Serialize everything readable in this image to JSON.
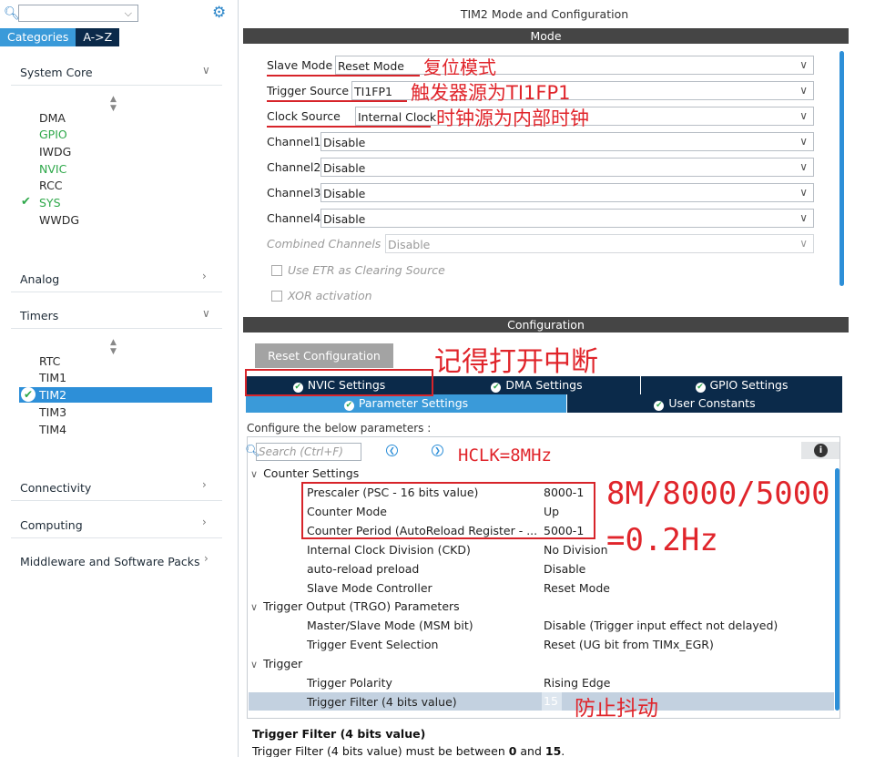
{
  "left": {
    "search_value": "",
    "tabs": [
      "Categories",
      "A->Z"
    ],
    "categories": {
      "system_core": "System Core",
      "system_core_items": [
        "DMA",
        "GPIO",
        "IWDG",
        "NVIC",
        "RCC",
        "SYS",
        "WWDG"
      ],
      "analog": "Analog",
      "timers": "Timers",
      "timers_items": [
        "RTC",
        "TIM1",
        "TIM2",
        "TIM3",
        "TIM4"
      ],
      "connectivity": "Connectivity",
      "computing": "Computing",
      "middleware": "Middleware and Software Packs"
    }
  },
  "right": {
    "title": "TIM2 Mode and Configuration",
    "mode_header": "Mode",
    "mode_rows": [
      {
        "label": "Slave Mode",
        "value": "Reset Mode"
      },
      {
        "label": "Trigger Source",
        "value": "TI1FP1"
      },
      {
        "label": "Clock Source",
        "value": "Internal Clock"
      },
      {
        "label": "Channel1",
        "value": "Disable"
      },
      {
        "label": "Channel2",
        "value": "Disable"
      },
      {
        "label": "Channel3",
        "value": "Disable"
      },
      {
        "label": "Channel4",
        "value": "Disable"
      },
      {
        "label": "Combined Channels",
        "value": "Disable"
      }
    ],
    "checkboxes": [
      "Use ETR as Clearing Source",
      "XOR activation"
    ],
    "config_header": "Configuration",
    "reset_button": "Reset Configuration",
    "tabs_row1": [
      "NVIC Settings",
      "DMA Settings",
      "GPIO Settings"
    ],
    "tabs_row2": [
      "Parameter Settings",
      "User Constants"
    ],
    "configure_label": "Configure the below parameters :",
    "search_placeholder": "Search (Ctrl+F)",
    "groups": [
      "Counter Settings",
      "Trigger Output (TRGO) Parameters",
      "Trigger"
    ],
    "params": [
      {
        "name": "Prescaler (PSC - 16 bits value)",
        "value": "8000-1"
      },
      {
        "name": "Counter Mode",
        "value": "Up"
      },
      {
        "name": "Counter Period (AutoReload Register - ...",
        "value": "5000-1"
      },
      {
        "name": "Internal Clock Division (CKD)",
        "value": "No Division"
      },
      {
        "name": "auto-reload preload",
        "value": "Disable"
      },
      {
        "name": "Slave Mode Controller",
        "value": "Reset Mode"
      },
      {
        "name": "Master/Slave Mode (MSM bit)",
        "value": "Disable (Trigger input effect not delayed)"
      },
      {
        "name": "Trigger Event Selection",
        "value": "Reset (UG bit from TIMx_EGR)"
      },
      {
        "name": "Trigger Polarity",
        "value": "Rising Edge"
      },
      {
        "name": "Trigger Filter (4 bits value)",
        "value": "15"
      }
    ],
    "desc_title": "Trigger Filter (4 bits value)",
    "desc_text_pre": "Trigger Filter (4 bits value) must be between ",
    "desc_min": "0",
    "desc_mid": " and ",
    "desc_max": "15",
    "desc_end": "."
  },
  "annotations": {
    "slave_mode": "复位模式",
    "trigger_source": "触发器源为TI1FP1",
    "clock_source": "时钟源为内部时钟",
    "nvic": "记得打开中断",
    "hclk": "HCLK=8MHz",
    "formula_line1": "8M/8000/5000",
    "formula_line2": "=0.2Hz",
    "filter": "防止抖动",
    "color": "#e0252b"
  }
}
